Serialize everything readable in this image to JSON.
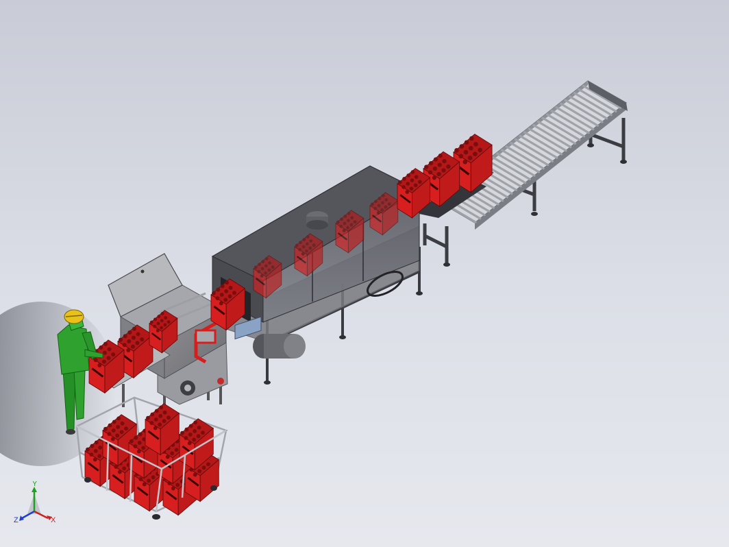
{
  "view": {
    "background_top": "#c9ccd6",
    "background_bottom": "#e6e8ee"
  },
  "colors": {
    "crate_red": "#d81f1f",
    "machine_dark": "#4a4a4e",
    "machine_glass": "#6d6e75",
    "steel": "#9a9ca3",
    "roller": "#c4c6cb",
    "operator_green": "#2fa12f",
    "helmet_yellow": "#e8c21a"
  },
  "triad": {
    "y_label": "Y",
    "x_label": "X",
    "z_label": "Z"
  }
}
